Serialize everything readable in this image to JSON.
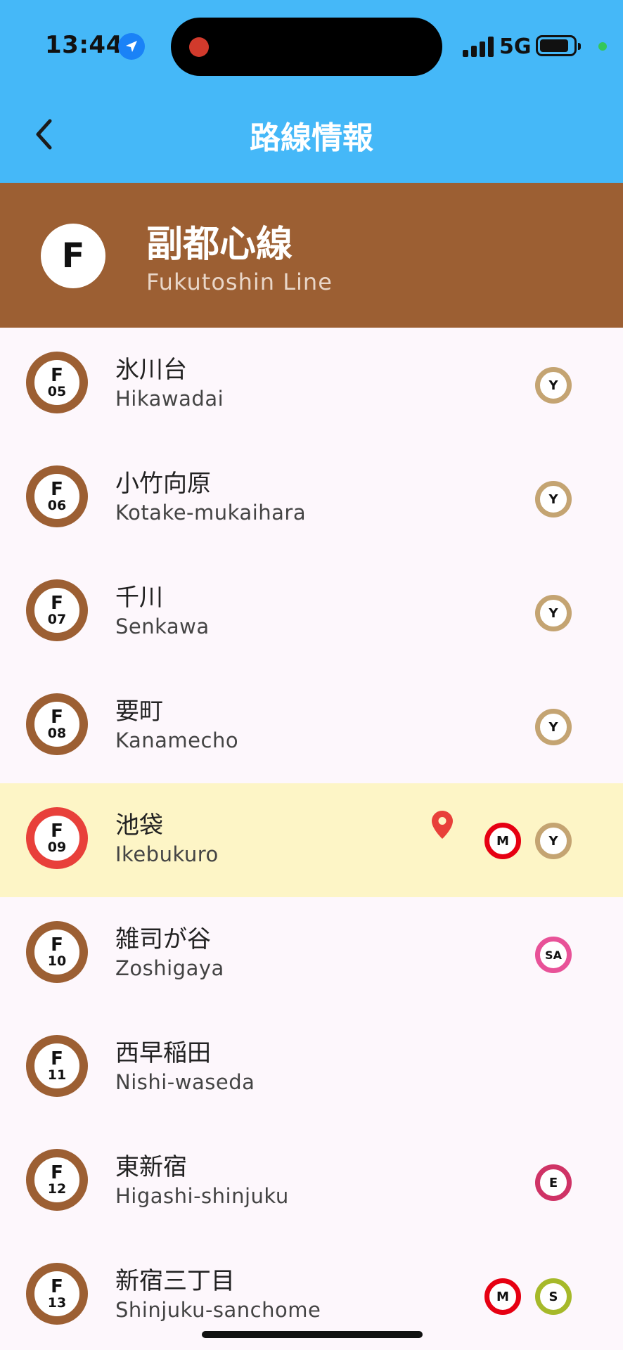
{
  "status_bar": {
    "time": "13:44",
    "network": "5G"
  },
  "app_bar": {
    "title": "路線情報",
    "back_icon": "chevron-left-icon"
  },
  "line": {
    "symbol": "F",
    "name_ja": "副都心線",
    "name_en": "Fukutoshin Line",
    "color": "#9c5f33"
  },
  "stations": [
    {
      "letter": "F",
      "num": "05",
      "name_ja": "氷川台",
      "name_en": "Hikawadai",
      "transfers": [
        "Y"
      ]
    },
    {
      "letter": "F",
      "num": "06",
      "name_ja": "小竹向原",
      "name_en": "Kotake-mukaihara",
      "transfers": [
        "Y"
      ]
    },
    {
      "letter": "F",
      "num": "07",
      "name_ja": "千川",
      "name_en": "Senkawa",
      "transfers": [
        "Y"
      ]
    },
    {
      "letter": "F",
      "num": "08",
      "name_ja": "要町",
      "name_en": "Kanamecho",
      "transfers": [
        "Y"
      ]
    },
    {
      "letter": "F",
      "num": "09",
      "name_ja": "池袋",
      "name_en": "Ikebukuro",
      "transfers": [
        "M",
        "Y"
      ],
      "current": true
    },
    {
      "letter": "F",
      "num": "10",
      "name_ja": "雑司が谷",
      "name_en": "Zoshigaya",
      "transfers": [
        "SA"
      ]
    },
    {
      "letter": "F",
      "num": "11",
      "name_ja": "西早稲田",
      "name_en": "Nishi-waseda",
      "transfers": []
    },
    {
      "letter": "F",
      "num": "12",
      "name_ja": "東新宿",
      "name_en": "Higashi-shinjuku",
      "transfers": [
        "E"
      ]
    },
    {
      "letter": "F",
      "num": "13",
      "name_ja": "新宿三丁目",
      "name_en": "Shinjuku-sanchome",
      "transfers": [
        "M",
        "S"
      ]
    }
  ],
  "transfer_colors": {
    "Y": "#c4a472",
    "M": "#e60012",
    "SA": "#e85298",
    "E": "#cf3366",
    "S": "#a6b92a"
  },
  "current_station_color": "#e8403a",
  "current_row_highlight": "#fdf5c6",
  "header_color": "#45b8f8"
}
